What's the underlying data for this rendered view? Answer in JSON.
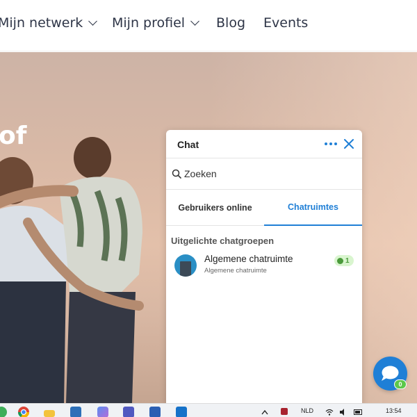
{
  "nav": {
    "items": [
      {
        "label": "Mijn netwerk",
        "has_dropdown": true
      },
      {
        "label": "Mijn profiel",
        "has_dropdown": true
      },
      {
        "label": "Blog",
        "has_dropdown": false
      },
      {
        "label": "Events",
        "has_dropdown": false
      }
    ]
  },
  "hero": {
    "title_fragment": "of"
  },
  "chat": {
    "title": "Chat",
    "search": {
      "value": "",
      "placeholder": "Zoeken"
    },
    "tabs": [
      {
        "label": "Gebruikers online",
        "active": false
      },
      {
        "label": "Chatruimtes",
        "active": true
      }
    ],
    "section_title": "Uitgelichte chatgroepen",
    "rooms": [
      {
        "name": "Algemene chatruimte",
        "subtitle": "Algemene chatruimte",
        "online_count": "1"
      }
    ],
    "accent_color": "#1f7fd6"
  },
  "fab": {
    "icon": "chat-bubble-icon",
    "badge": "0"
  },
  "taskbar": {
    "apps": [
      "app-green-icon",
      "chrome-icon",
      "file-explorer-icon",
      "store-icon",
      "copilot-icon",
      "teams-icon",
      "word-icon",
      "outlook-icon"
    ],
    "language": "NLD",
    "time": "13:54"
  }
}
